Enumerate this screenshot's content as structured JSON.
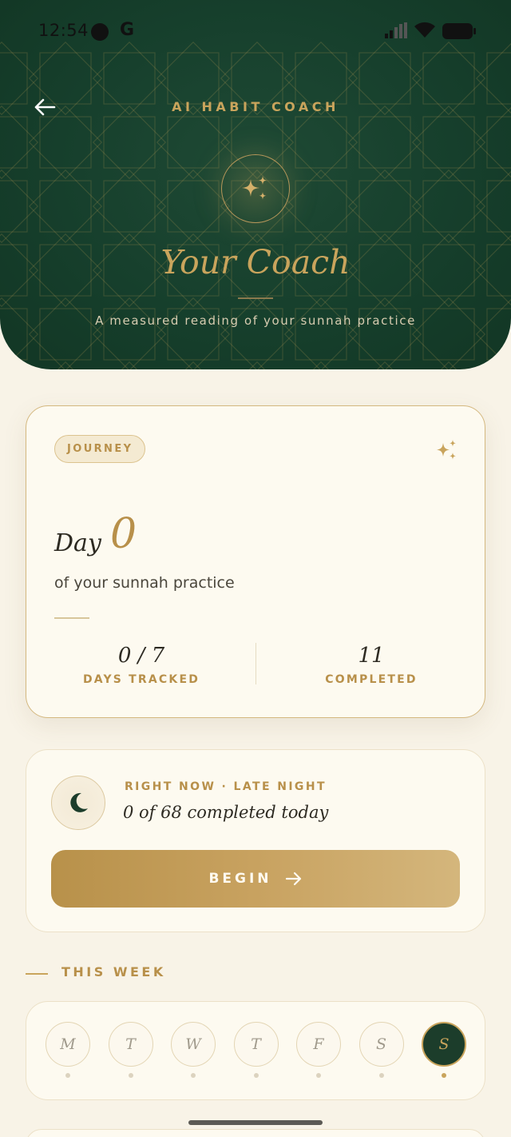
{
  "status_bar": {
    "time": "12:54",
    "g_label": "G"
  },
  "header": {
    "eyebrow": "AI HABIT COACH",
    "title": "Your Coach",
    "subtitle": "A measured reading of your sunnah practice",
    "back_icon": "arrow-left-icon",
    "coach_icon": "sparkles-icon"
  },
  "journey": {
    "pill": "JOURNEY",
    "day_word": "Day",
    "day_number": "0",
    "caption": "of your sunnah practice",
    "stats": [
      {
        "value": "0 / 7",
        "label": "DAYS TRACKED"
      },
      {
        "value": "11",
        "label": "COMPLETED"
      }
    ]
  },
  "now": {
    "eyebrow": "RIGHT NOW · LATE NIGHT",
    "status": "0 of 68 completed today",
    "button_label": "BEGIN",
    "icon": "crescent-moon-icon"
  },
  "week": {
    "heading": "THIS WEEK",
    "days": [
      {
        "letter": "M",
        "active": false
      },
      {
        "letter": "T",
        "active": false
      },
      {
        "letter": "W",
        "active": false
      },
      {
        "letter": "T",
        "active": false
      },
      {
        "letter": "F",
        "active": false
      },
      {
        "letter": "S",
        "active": false
      },
      {
        "letter": "S",
        "active": true
      }
    ]
  },
  "colors": {
    "header_green": "#163f2c",
    "gold": "#c9a45c",
    "cream": "#f8f3e7"
  }
}
